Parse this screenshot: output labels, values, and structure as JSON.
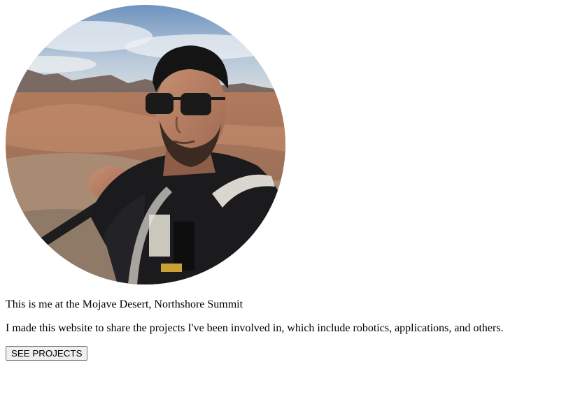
{
  "profile": {
    "photo_icon": "portrait-photo",
    "caption": "This is me at the Mojave Desert, Northshore Summit",
    "intro": "I made this website to share the projects I've been involved in, which include robotics, applications, and others."
  },
  "actions": {
    "see_projects_label": "SEE PROJECTS"
  }
}
